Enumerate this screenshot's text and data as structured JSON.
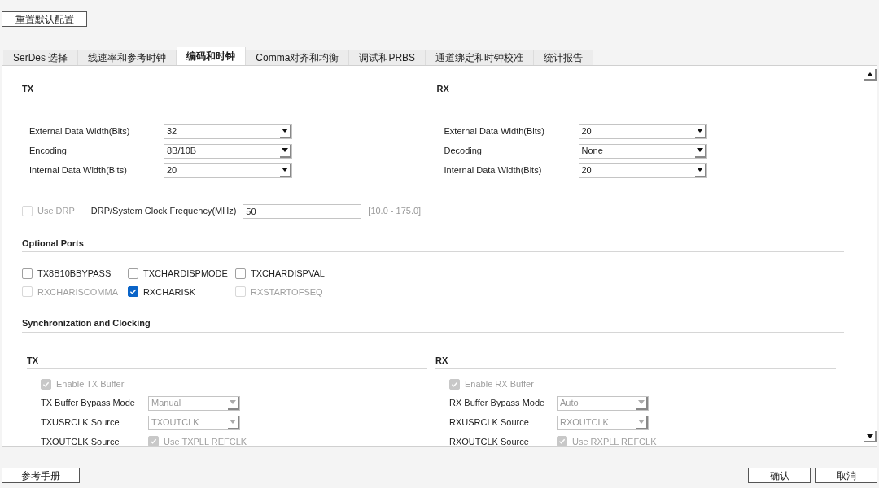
{
  "reset_button": "重置默认配置",
  "tabs": [
    {
      "label": "SerDes 选择",
      "selected": false
    },
    {
      "label": "线速率和参考时钟",
      "selected": false
    },
    {
      "label": "编码和时钟",
      "selected": true
    },
    {
      "label": "Comma对齐和均衡",
      "selected": false
    },
    {
      "label": "调试和PRBS",
      "selected": false
    },
    {
      "label": "通道绑定和时钟校准",
      "selected": false
    },
    {
      "label": "统计报告",
      "selected": false
    }
  ],
  "tx": {
    "title": "TX",
    "fields": [
      {
        "label": "External Data Width(Bits)",
        "value": "32"
      },
      {
        "label": "Encoding",
        "value": "8B/10B"
      },
      {
        "label": "Internal Data Width(Bits)",
        "value": "20"
      }
    ]
  },
  "rx": {
    "title": "RX",
    "fields": [
      {
        "label": "External Data Width(Bits)",
        "value": "20"
      },
      {
        "label": "Decoding",
        "value": "None"
      },
      {
        "label": "Internal Data Width(Bits)",
        "value": "20"
      }
    ]
  },
  "drp": {
    "checkbox": {
      "label": "Use DRP",
      "checked": false,
      "disabled": true
    },
    "label": "DRP/System Clock Frequency(MHz)",
    "value": "50",
    "range": "[10.0 - 175.0]"
  },
  "optional_ports": {
    "title": "Optional Ports",
    "ports": [
      {
        "label": "TX8B10BBYPASS",
        "checked": false,
        "disabled": false
      },
      {
        "label": "TXCHARDISPMODE",
        "checked": false,
        "disabled": false
      },
      {
        "label": "TXCHARDISPVAL",
        "checked": false,
        "disabled": false
      },
      {
        "label": "RXCHARISCOMMA",
        "checked": false,
        "disabled": true
      },
      {
        "label": "RXCHARISK",
        "checked": true,
        "disabled": false
      },
      {
        "label": "RXSTARTOFSEQ",
        "checked": false,
        "disabled": true
      }
    ]
  },
  "sync": {
    "title": "Synchronization and Clocking",
    "columns": [
      {
        "title": "TX",
        "enable": {
          "label": "Enable TX Buffer",
          "checked": true,
          "disabled": true
        },
        "fields": [
          {
            "label": "TX Buffer Bypass Mode",
            "value": "Manual",
            "disabled": true
          },
          {
            "label": "TXUSRCLK Source",
            "value": "TXOUTCLK",
            "disabled": true
          }
        ],
        "outclk": {
          "label": "TXOUTCLK Source",
          "checkbox": {
            "label": "Use TXPLL REFCLK",
            "checked": true,
            "disabled": true
          }
        }
      },
      {
        "title": "RX",
        "enable": {
          "label": "Enable RX Buffer",
          "checked": true,
          "disabled": true
        },
        "fields": [
          {
            "label": "RX Buffer Bypass Mode",
            "value": "Auto",
            "disabled": true
          },
          {
            "label": "RXUSRCLK Source",
            "value": "RXOUTCLK",
            "disabled": true
          }
        ],
        "outclk": {
          "label": "RXOUTCLK Source",
          "checkbox": {
            "label": "Use RXPLL REFCLK",
            "checked": true,
            "disabled": true
          }
        }
      }
    ]
  },
  "footer": {
    "manual_button": "参考手册",
    "ok_button": "确认",
    "cancel_button": "取消"
  }
}
